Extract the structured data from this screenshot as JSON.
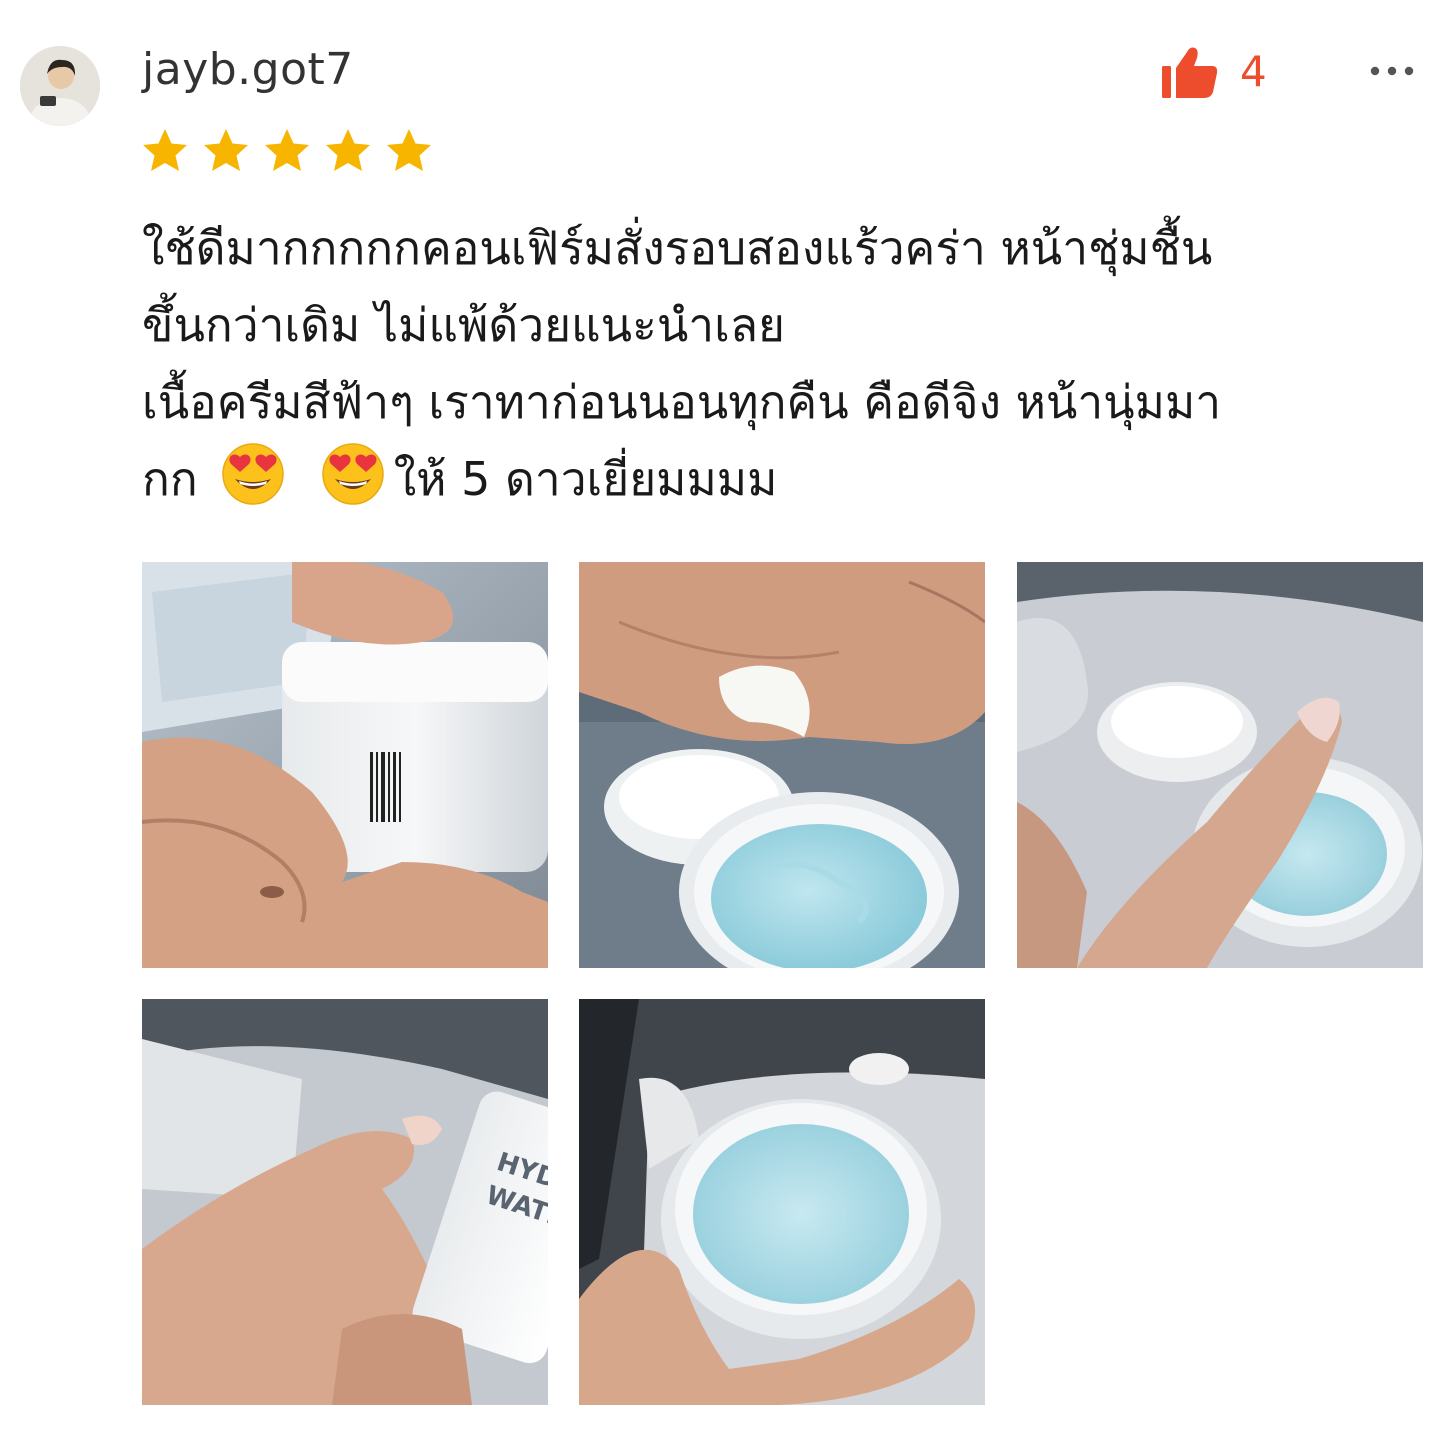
{
  "review": {
    "username": "jayb.got7",
    "rating": 5,
    "like_count": "4",
    "comment_lines": [
      "ใช้ดีมากกกกกคอนเฟิร์มสั่งรอบสองแร้วคร่า หน้าชุ่มชื้น",
      "ขึ้นกว่าเดิม  ไม่แพ้ด้วยแนะนำเลย",
      "เนื้อครีมสีฟ้าๆ เราทาก่อนนอนทุกคืน คือดีจิง หน้านุ่มมา",
      "กก",
      "ให้ 5 ดาวเยี่ยมมมม"
    ],
    "product_label_text": {
      "jar_text_1": "HYDRA",
      "jar_text_2": "WATER"
    }
  },
  "icons": {
    "like": "thumbs-up-icon",
    "more": "more-dots-icon",
    "star": "star-icon",
    "emoji": "heart-eyes-emoji"
  },
  "colors": {
    "accent": "#ee4d2d",
    "star": "#f7b500",
    "text": "#1a1a1a",
    "username": "#333333"
  }
}
